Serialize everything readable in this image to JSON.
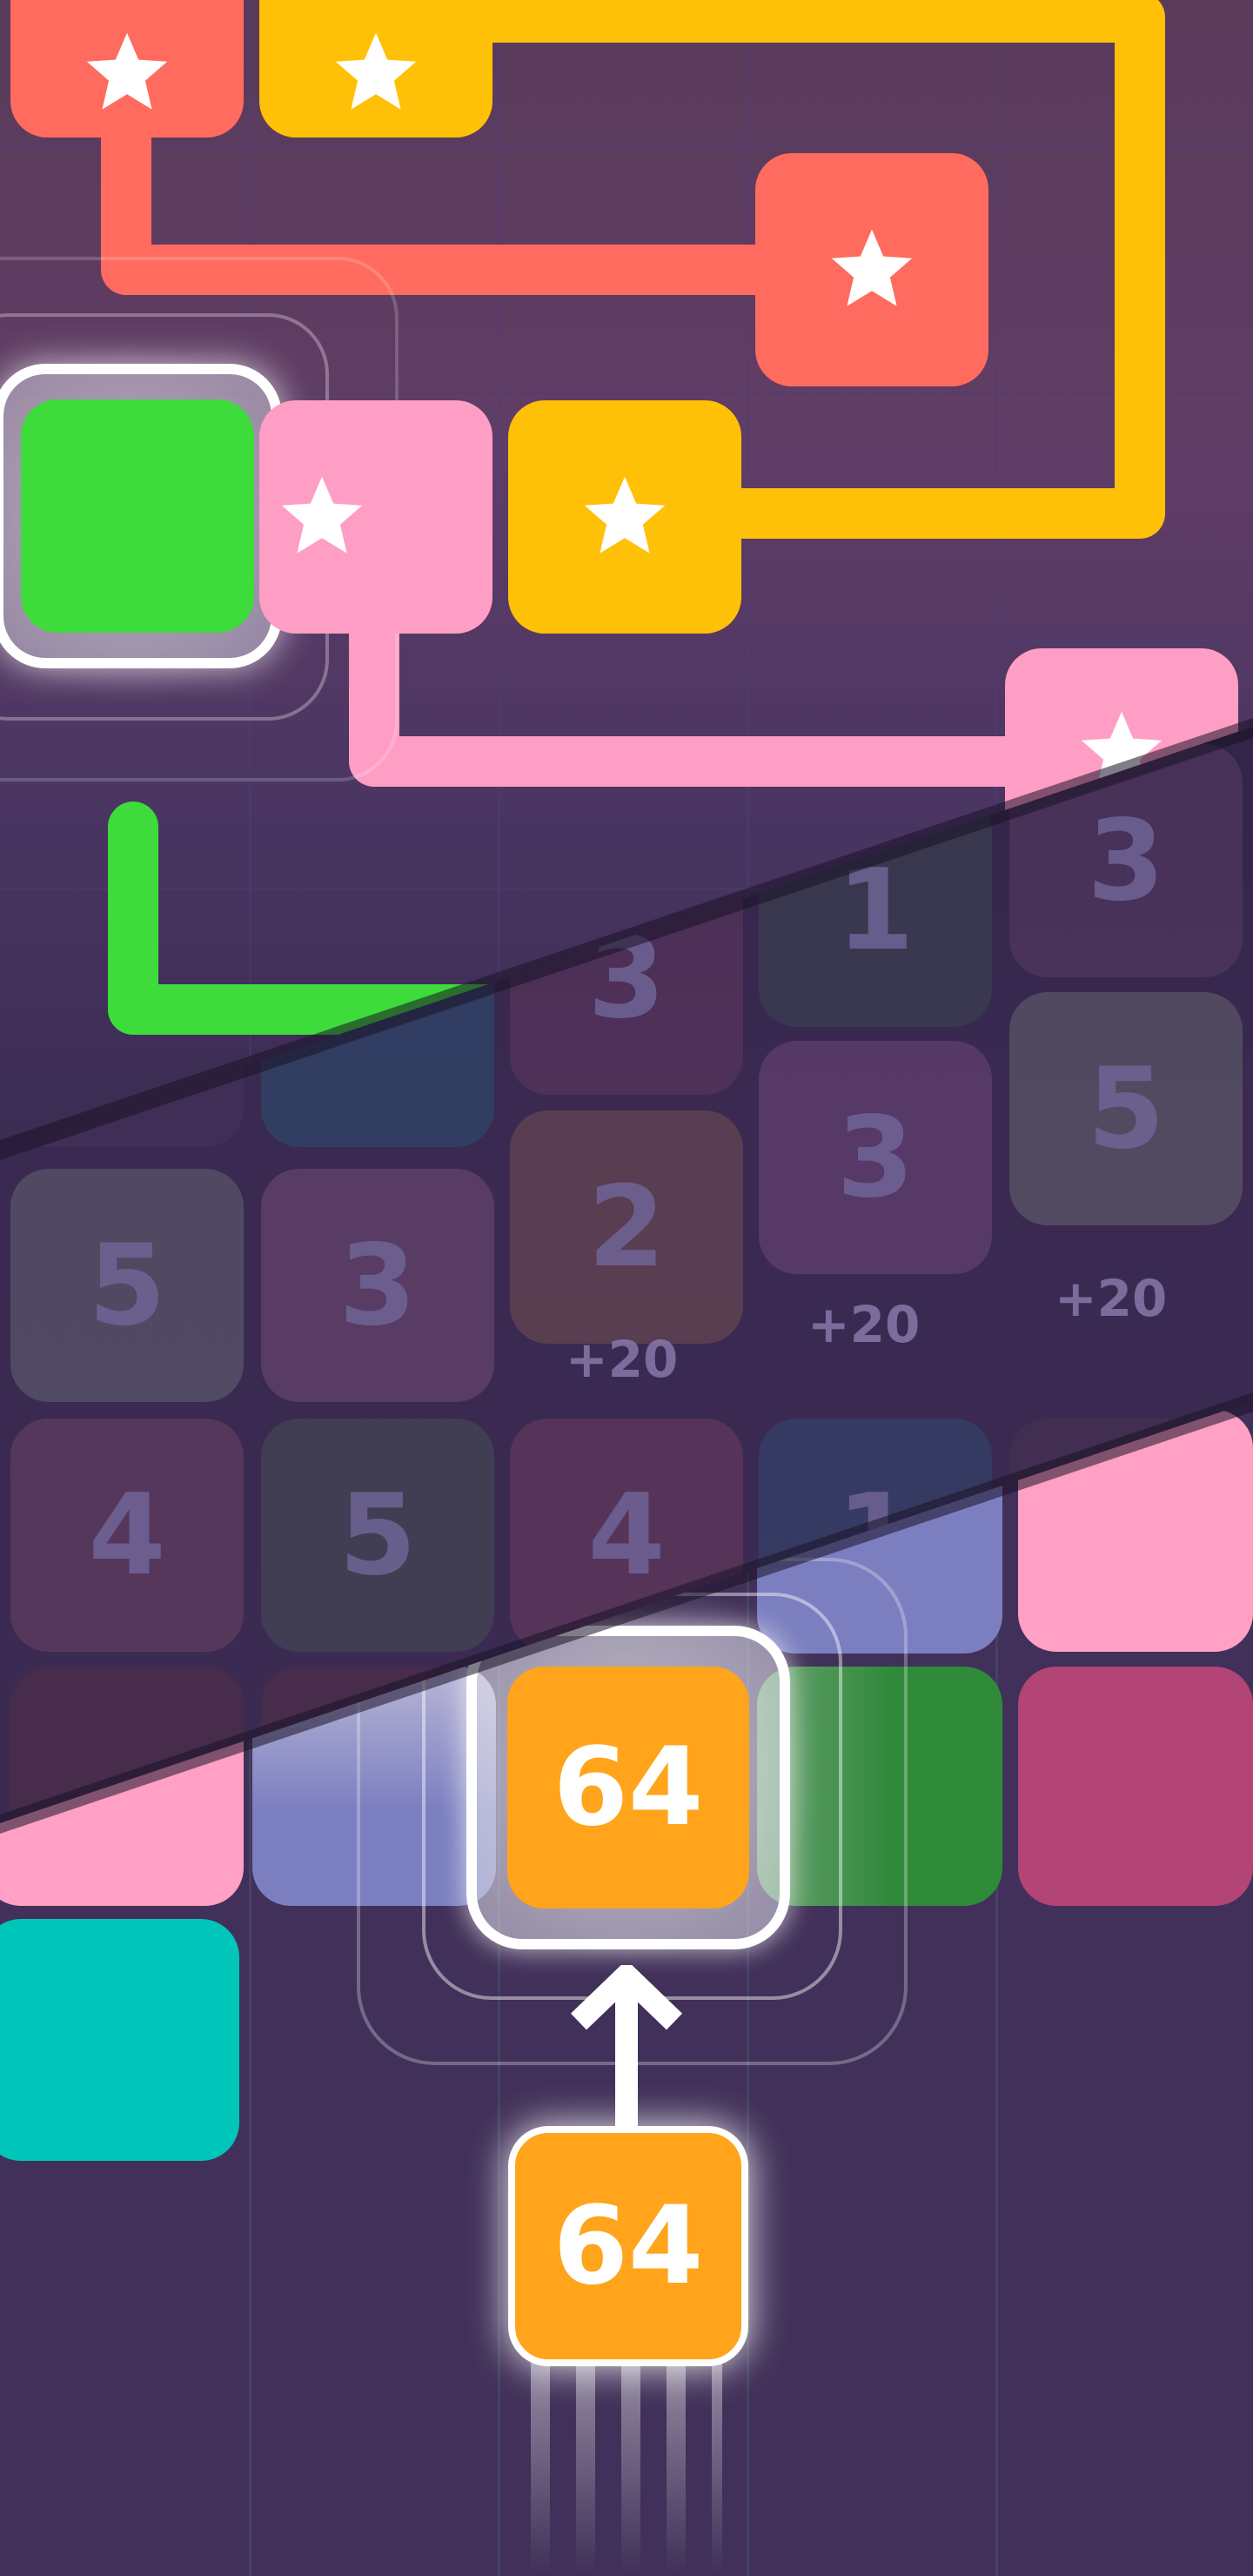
{
  "panel_top": {
    "path_colors": {
      "red": "#ff6b5e",
      "yellow": "#ffc107",
      "pink": "#ff9ec5",
      "green": "#3ddc3a"
    },
    "board_color": "#5e3d62",
    "tiles": [
      {
        "color": "red",
        "icon": "star-icon"
      },
      {
        "color": "yellow",
        "icon": "star-icon"
      },
      {
        "color": "red",
        "icon": "star-icon"
      },
      {
        "color": "green",
        "icon": ""
      },
      {
        "color": "pink",
        "icon": "star-icon"
      },
      {
        "color": "yellow",
        "icon": "star-icon"
      },
      {
        "color": "pink",
        "icon": "star-icon"
      }
    ]
  },
  "panel_middle": {
    "tiles": [
      {
        "value": "3"
      },
      {
        "value": "1"
      },
      {
        "value": "3"
      },
      {
        "value": "5"
      },
      {
        "value": "3"
      },
      {
        "value": "5"
      },
      {
        "value": "3"
      },
      {
        "value": "2"
      },
      {
        "value": "4"
      },
      {
        "value": "5"
      },
      {
        "value": "4"
      },
      {
        "value": "1"
      }
    ],
    "bonuses": [
      "+20",
      "+20",
      "+20"
    ]
  },
  "panel_bottom": {
    "merged_tile": {
      "value": "64",
      "color": "#ffa41b"
    },
    "shooter_tile": {
      "value": "64",
      "color": "#ffa41b"
    },
    "arrow_icon": "arrow-up-icon",
    "colors": {
      "pink": "#ffa0c4",
      "blue": "#7b7fc0",
      "green": "#2f8a3a",
      "magenta": "#b24576",
      "teal": "#00c6ba"
    }
  }
}
